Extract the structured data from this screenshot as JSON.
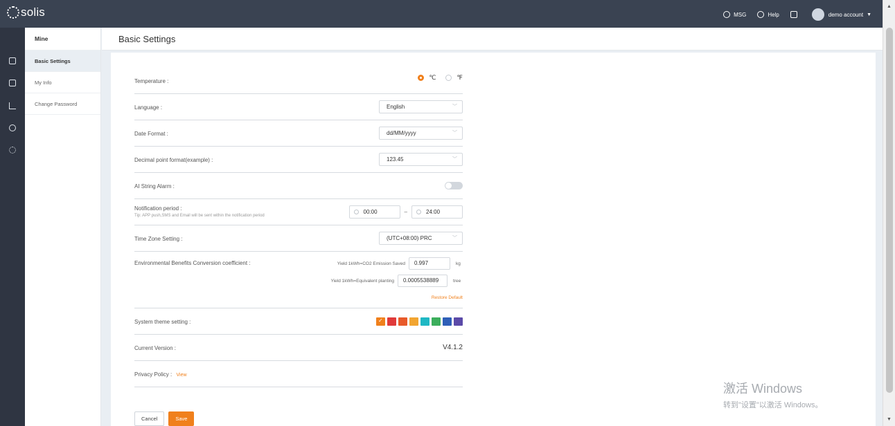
{
  "app": {
    "logo_text": "solis"
  },
  "topnav": {
    "msg": "MSG",
    "help": "Help",
    "account": "demo account"
  },
  "sidebar_icons": [
    "grid-icon",
    "document-icon",
    "chart-icon",
    "eye-icon",
    "apps-icon"
  ],
  "submenu": {
    "title": "Mine",
    "items": [
      "Basic Settings",
      "My Info",
      "Change Password"
    ]
  },
  "page": {
    "title": "Basic Settings"
  },
  "form": {
    "temperature": {
      "label": "Temperature :",
      "opt_c": "℃",
      "opt_f": "℉",
      "selected": "℃"
    },
    "language": {
      "label": "Language :",
      "value": "English"
    },
    "date_format": {
      "label": "Date Format :",
      "value": "dd/MM/yyyy"
    },
    "decimal": {
      "label": "Decimal point format(example) :",
      "value": "123.45"
    },
    "ai_alarm": {
      "label": "AI String Alarm :",
      "enabled": false
    },
    "notification": {
      "label": "Notification period :",
      "tip": "Tip: APP push,SMS and Email will be sent within the notification period",
      "start": "00:00",
      "separator": "–",
      "end": "24:00"
    },
    "timezone": {
      "label": "Time Zone Setting :",
      "value": "(UTC+08:00) PRC"
    },
    "env": {
      "label": "Environmental Benefits Conversion coefficient :",
      "co2_label": "Yield 1kWh=CO2 Emission Saved",
      "co2_value": "0.997",
      "co2_unit": "kg",
      "tree_label": "Yield 1kWh=Equivalent planting",
      "tree_value": "0.0005538889",
      "tree_unit": "tree",
      "restore": "Restore Default"
    },
    "theme": {
      "label": "System theme setting :",
      "colors": [
        "#f0801c",
        "#e03a3a",
        "#e85a2a",
        "#f2a531",
        "#1fb8c4",
        "#3cae5c",
        "#2f5fb8",
        "#5b4aa8"
      ]
    },
    "version": {
      "label": "Current Version :",
      "value": "V4.1.2"
    },
    "privacy": {
      "label": "Privacy Policy :",
      "link": "View"
    }
  },
  "buttons": {
    "cancel": "Cancel",
    "save": "Save"
  },
  "watermark": {
    "line1": "激活 Windows",
    "line2": "转到\"设置\"以激活 Windows。"
  }
}
